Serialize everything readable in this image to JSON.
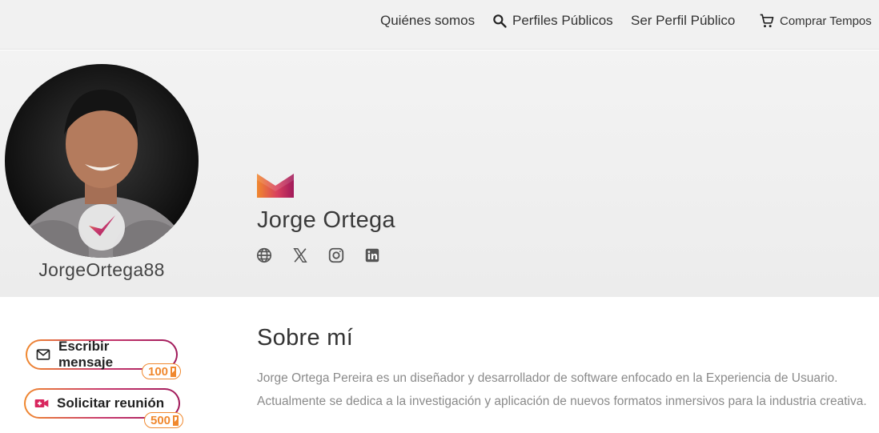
{
  "nav": {
    "about_label": "Quiénes somos",
    "profiles_label": "Perfiles Públicos",
    "public_profile_label": "Ser Perfil Público",
    "buy_label": "Comprar Tempos"
  },
  "profile": {
    "username": "JorgeOrtega88",
    "full_name": "Jorge Ortega",
    "social_icons": [
      "globe-icon",
      "x-icon",
      "instagram-icon",
      "linkedin-icon"
    ]
  },
  "actions": {
    "message_label": "Escribir mensaje",
    "message_price": "100",
    "meeting_label": "Solicitar reunión",
    "meeting_price": "500"
  },
  "about": {
    "title": "Sobre mí",
    "text": "Jorge Ortega Pereira es un diseñador y desarrollador de software enfocado en la Experiencia de Usuario. Actualmente se dedica a la investigación y aplicación de nuevos formatos inmersivos para la industria creativa."
  },
  "colors": {
    "accent_orange": "#f0882e",
    "accent_magenta": "#c83b6e",
    "accent_purple": "#a0195a"
  }
}
